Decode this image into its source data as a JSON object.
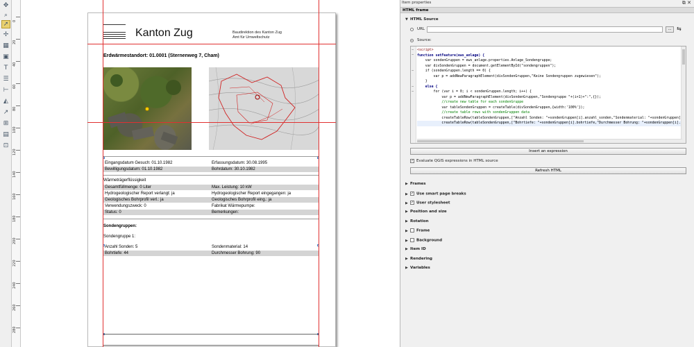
{
  "toolbar": {
    "icons": [
      "pan-icon",
      "zoom-icon",
      "select-icon",
      "move-content-icon",
      "add-map-icon",
      "add-image-icon",
      "add-label-icon",
      "add-legend-icon",
      "add-scalebar-icon",
      "add-shape-icon",
      "add-arrow-icon",
      "add-attribute-table-icon",
      "add-html-frame-icon"
    ]
  },
  "ruler": {
    "labels": [
      "0",
      "20",
      "40",
      "60",
      "80",
      "100",
      "120",
      "140",
      "160",
      "180",
      "200",
      "220",
      "240",
      "260",
      "280"
    ]
  },
  "layout": {
    "header": {
      "kanton": "Kanton Zug",
      "directorate": "Baudirektion des Kanton Zug",
      "office": "Amt für Umweltschutz"
    },
    "site_title": "Erdwärmestandort: 01.0001 (Sternenweg 7, Cham)",
    "dates": [
      {
        "left": "Eingangsdatum Gesuch: 01.10.1982",
        "right": "Erfassungsdatum: 30.08.1995",
        "grey": false
      },
      {
        "left": "Bewilligungsdatum: 01.10.1982",
        "right": "Bohrdatum: 30.10.1982",
        "grey": true
      }
    ],
    "fluid_heading": "Wärmeträgerflüssigkeit",
    "fluid_rows": [
      {
        "left": "Gesamtfüllmenge: 0 Liter",
        "right": "Max. Leistung: 10 kW",
        "grey": true
      },
      {
        "left": "Hydrogeologischer Report verlangt: ja",
        "right": "Hydrogeologischer Report eingegangen: ja",
        "grey": false
      },
      {
        "left": "Geologisches Bohrprofil verl.: ja",
        "right": "Geologisches Bohrprofil eing.: ja",
        "grey": true
      },
      {
        "left": "Verwendungszweck: 0",
        "right": "Fabrikat Wärmepumpe:",
        "grey": false
      },
      {
        "left": "Status: 0",
        "right": "Bemerkungen:",
        "grey": true
      }
    ],
    "sonden_heading": "Sondengruppen:",
    "group_label": "Sondengruppe 1:",
    "group_rows": [
      {
        "left": "Anzahl Sonden: 5",
        "right": "Sondenmaterial: 14",
        "grey": false
      },
      {
        "left": "Bohrtiefe: 44",
        "right": "Durchmesser Bohrung: 90",
        "grey": true
      }
    ]
  },
  "panel": {
    "title": "Item properties",
    "frame_title": "HTML frame",
    "html_source_label": "HTML Source",
    "url_label": "URL",
    "url_value": "",
    "url_browse": "...",
    "source_label": "Source:",
    "code_lines": [
      "<script>",
      "function setFeature(ews_anlage) {",
      "    var sondenGruppen = ews_anlage.properties.Anlage_Sondengruppe;",
      "    var divSondenGruppen = document.getElementById(\"sondengruppen\");",
      "    if (sondenGruppen.length == 0) {",
      "        var p = addNewParagraphElement(divSondenGruppen,\"Keine Sondengruppen zugewiesen\");",
      "    }",
      "    else {",
      "        for (var i = 0; i < sondenGruppen.length; i++) {",
      "            var p = addNewParagraphElement(divSondenGruppen,\"Sondengruppe \"+(i+1)+\":\",{});",
      "            //create new table for each sondenGruppe",
      "            var tableSondenGruppen = createTable(divSondenGruppen,{width:'100%'});",
      "            //create table rows with sondenGruppen data",
      "            createTableRow(tableSondenGruppen,[\"Anzahl Sonden: \"+sondenGruppen[i].anzahl_sonden,\"Sondenmaterial: \"+sondenGruppen[",
      "            createTableRow(tableSondenGruppen,[\"Bohrtiefe: \"+sondenGruppen[i].bohrtiefe,\"Durchmesser Bohrung: \"+sondenGruppen[i]."
    ],
    "insert_expression": "Insert an expression",
    "evaluate_label": "Evaluate QGIS expressions in HTML source",
    "refresh_html": "Refresh HTML",
    "sections": [
      {
        "label": "Frames",
        "checkbox": false,
        "checked": false
      },
      {
        "label": "Use smart page breaks",
        "checkbox": true,
        "checked": true
      },
      {
        "label": "User stylesheet",
        "checkbox": true,
        "checked": true
      },
      {
        "label": "Position and size",
        "checkbox": false,
        "checked": false
      },
      {
        "label": "Rotation",
        "checkbox": false,
        "checked": false
      },
      {
        "label": "Frame",
        "checkbox": true,
        "checked": false
      },
      {
        "label": "Background",
        "checkbox": true,
        "checked": false
      },
      {
        "label": "Item ID",
        "checkbox": false,
        "checked": false
      },
      {
        "label": "Rendering",
        "checkbox": false,
        "checked": false
      },
      {
        "label": "Variables",
        "checkbox": false,
        "checked": false
      }
    ],
    "accent_color": "#e03030"
  }
}
